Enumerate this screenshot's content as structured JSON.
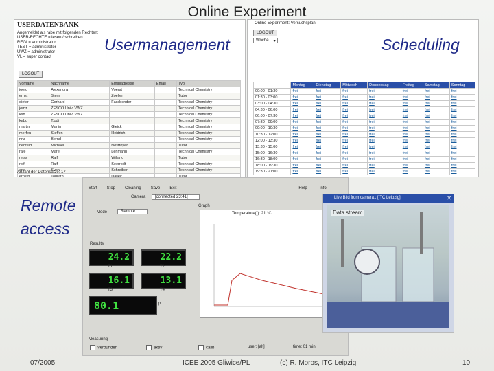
{
  "slide": {
    "title": "Online Experiment",
    "label_usermanagement": "Usermanagement",
    "label_scheduling": "Scheduling",
    "label_remote1": "Remote",
    "label_remote2": "access",
    "footer_date": "07/2005",
    "footer_conf": "ICEE 2005 Gliwice/PL",
    "footer_author": "(c) R. Moros, ITC Leipzig",
    "footer_page": "10"
  },
  "usermgmt": {
    "heading": "USERDATENBANK",
    "info_lines": [
      "Angemeldet als rabe mit folgenden Rechten:",
      "USER-RECHTE  = lesen / schreiben",
      "REGI = administrator",
      "TEST = administrator",
      "UWZ = administrator",
      "VL = super contact"
    ],
    "logout": "LOGOUT",
    "columns": [
      "Vorname",
      "Nachname",
      "Emailadresse",
      "Email",
      "Typ"
    ],
    "rows": [
      [
        "joerg",
        "Alexandra",
        "Voerst",
        "",
        "Technical Chemistry"
      ],
      [
        "ernst",
        "Stern",
        "Zoeller",
        "",
        "Tutor"
      ],
      [
        "dieter",
        "Gerhard",
        "Fassbender",
        "",
        "Technical Chemistry"
      ],
      [
        "jemz",
        "ZESCO Univ. VWZ",
        "",
        "",
        "Technical Chemistry"
      ],
      [
        "ksh",
        "ZESCO Univ. VWZ",
        "",
        "",
        "Technical Chemistry"
      ],
      [
        "kabo",
        "T.odi",
        "",
        "",
        "Technical Chemistry"
      ],
      [
        "martin",
        "Marlin",
        "Gleick",
        "",
        "Technical Chemistry"
      ],
      [
        "merfeu",
        "Steffen",
        "Heidrich",
        "",
        "Technical Chemistry"
      ],
      [
        "nnz",
        "Bernd",
        "",
        "",
        "Technical Chemistry"
      ],
      [
        "nenfeld",
        "Michael",
        "Nestroyer",
        "",
        "Tutor"
      ],
      [
        "rafe",
        "Mare",
        "Lehmann",
        "",
        "Technical Chemistry"
      ],
      [
        "reiss",
        "Ralf",
        "Willand",
        "",
        "Tutor"
      ],
      [
        "rolf",
        "Ralf",
        "Seerrodt",
        "",
        "Technical Chemistry"
      ],
      [
        "ans",
        "Sven",
        "Schreiber",
        "",
        "Technical Chemistry"
      ],
      [
        "ernsth",
        "Tobrath",
        "Dalley",
        "",
        "Tutor"
      ]
    ],
    "count": "Anzahl der Datensätze: 17"
  },
  "schedule": {
    "header": "Online Experiment: Versuchsplan",
    "logout": "LOGOUT",
    "select_value": "Woche",
    "days": [
      "Montag",
      "Dienstag",
      "Mittwoch",
      "Donnerstag",
      "Freitag",
      "Samstag",
      "Sonntag"
    ],
    "times": [
      "00:00 - 01:30",
      "01:30 - 03:00",
      "03:00 - 04:30",
      "04:30 - 06:00",
      "06:00 - 07:30",
      "07:30 - 09:00",
      "09:00 - 10:30",
      "10:30 - 12:00",
      "12:00 - 13:30",
      "13:30 - 15:00",
      "15:00 - 16:30",
      "16:30 - 18:00",
      "18:00 - 19:30",
      "19:30 - 21:00"
    ],
    "cell": "frei"
  },
  "remote": {
    "menu": [
      "Start",
      "Stop",
      "Cleaning",
      "Save",
      "Exit",
      "Help",
      "Info"
    ],
    "camera_label": "Camera",
    "camera_value": "[connected 23:41]",
    "mode_label": "Mode",
    "mode_value": "Remote",
    "results_label": "Results",
    "graph_label": "Graph",
    "graph_title": "Temperature(t): 21 °C",
    "lcd_values": [
      "24.2",
      "22.2",
      "16.1",
      "13.1",
      "80.1"
    ],
    "lcd_labels": [
      "T1",
      "T2",
      "T3",
      "T4",
      "p"
    ],
    "measure_label": "Measuring",
    "status_items": [
      "Verbunden",
      "aktiv",
      "calib"
    ],
    "user_label": "user: [alt]",
    "time_label": "time: 01 min",
    "camera_window_title": "Live Bild from camera1 [ITC Leipzig]",
    "camera_caption": "Data stream"
  },
  "colors": {
    "accent": "#1f2a88",
    "lcd": "#40e040"
  }
}
